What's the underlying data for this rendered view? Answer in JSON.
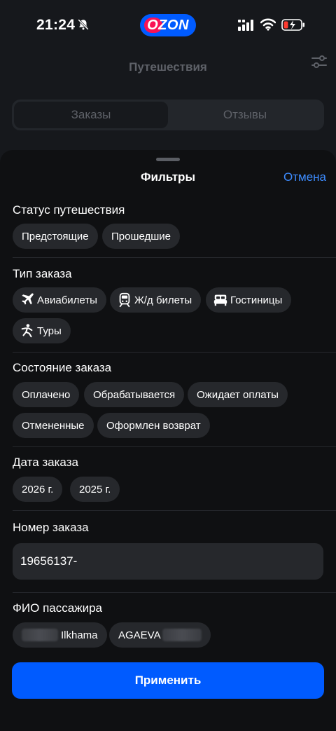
{
  "status_bar": {
    "time": "21:24",
    "logo_text": "OZON",
    "colors": {
      "logo_bg": "#005bff",
      "logo_accent": "#f91155",
      "battery_low": "#ff3b30"
    }
  },
  "header": {
    "title": "Путешествия",
    "tabs": [
      {
        "label": "Заказы",
        "active": true
      },
      {
        "label": "Отзывы",
        "active": false
      }
    ]
  },
  "sheet": {
    "title": "Фильтры",
    "cancel_label": "Отмена",
    "sections": {
      "trip_status": {
        "title": "Статус путешествия",
        "chips": [
          "Предстоящие",
          "Прошедшие"
        ]
      },
      "order_type": {
        "title": "Тип заказа",
        "chips": [
          {
            "label": "Авиабилеты",
            "icon": "plane-icon"
          },
          {
            "label": "Ж/д билеты",
            "icon": "train-icon"
          },
          {
            "label": "Гостиницы",
            "icon": "bed-icon"
          },
          {
            "label": "Туры",
            "icon": "person-tour-icon"
          }
        ]
      },
      "order_state": {
        "title": "Состояние заказа",
        "chips": [
          "Оплачено",
          "Обрабатывается",
          "Ожидает оплаты",
          "Отмененные",
          "Оформлен возврат"
        ]
      },
      "order_date": {
        "title": "Дата заказа",
        "chips": [
          "2026 г.",
          "2025 г."
        ]
      },
      "order_number": {
        "title": "Номер заказа",
        "value": "19656137-"
      },
      "passenger_name": {
        "title": "ФИО пассажира",
        "chips": [
          "Ilkhama",
          "AGAEVA"
        ]
      }
    },
    "apply_label": "Применить",
    "colors": {
      "accent": "#005bff",
      "link": "#3d8bfd",
      "chip_bg": "#26282c"
    }
  }
}
